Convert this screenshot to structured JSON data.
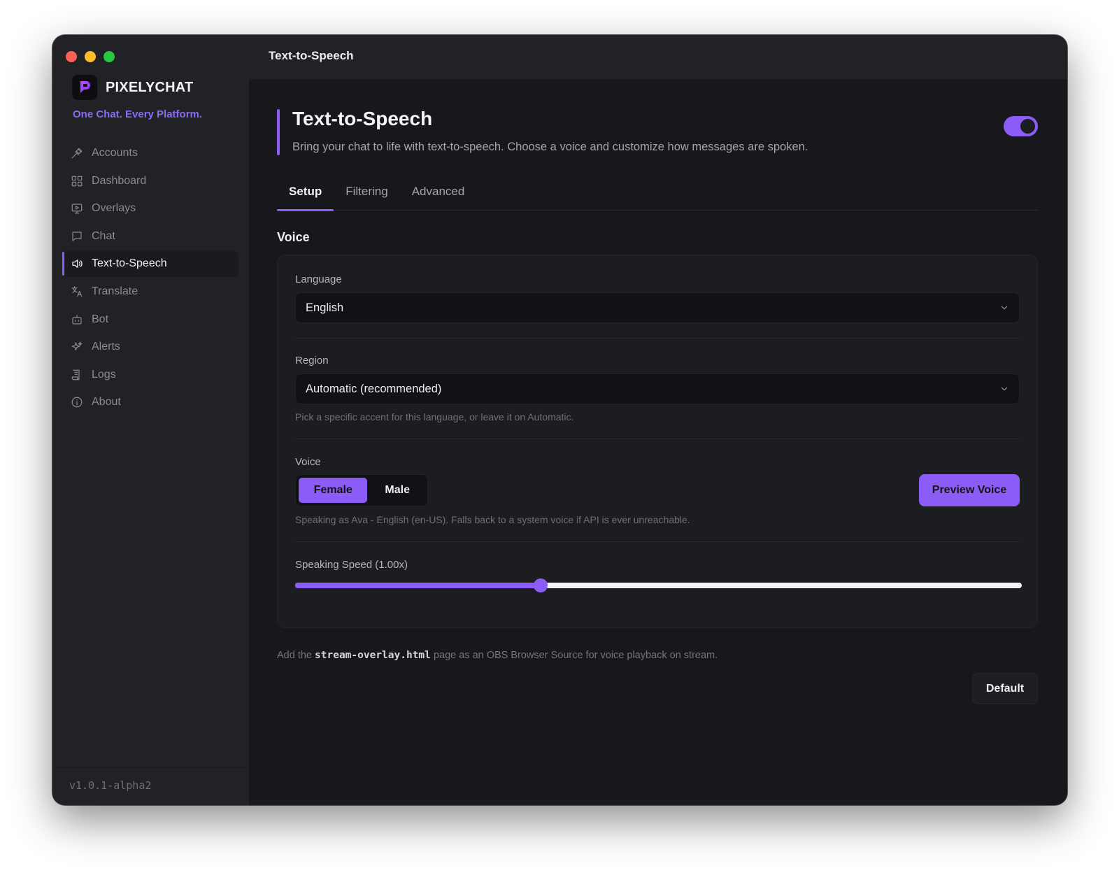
{
  "app": {
    "name": "PIXELYCHAT",
    "tagline": "One Chat. Every Platform.",
    "version": "v1.0.1-alpha2",
    "window_title": "Text-to-Speech",
    "accent_color": "#8b5cf6"
  },
  "sidebar": {
    "items": [
      {
        "label": "Accounts",
        "icon": "plug-icon",
        "active": false
      },
      {
        "label": "Dashboard",
        "icon": "dashboard-icon",
        "active": false
      },
      {
        "label": "Overlays",
        "icon": "monitor-play-icon",
        "active": false
      },
      {
        "label": "Chat",
        "icon": "chat-bubble-icon",
        "active": false
      },
      {
        "label": "Text-to-Speech",
        "icon": "speaker-icon",
        "active": true
      },
      {
        "label": "Translate",
        "icon": "translate-icon",
        "active": false
      },
      {
        "label": "Bot",
        "icon": "bot-icon",
        "active": false
      },
      {
        "label": "Alerts",
        "icon": "sparkles-icon",
        "active": false
      },
      {
        "label": "Logs",
        "icon": "logs-icon",
        "active": false
      },
      {
        "label": "About",
        "icon": "info-icon",
        "active": false
      }
    ]
  },
  "header": {
    "title": "Text-to-Speech",
    "description": "Bring your chat to life with text-to-speech. Choose a voice and customize how messages are spoken.",
    "enabled": true
  },
  "tabs": [
    {
      "label": "Setup",
      "active": true
    },
    {
      "label": "Filtering",
      "active": false
    },
    {
      "label": "Advanced",
      "active": false
    }
  ],
  "voice_section": {
    "title": "Voice",
    "language": {
      "label": "Language",
      "value": "English"
    },
    "region": {
      "label": "Region",
      "value": "Automatic (recommended)",
      "hint": "Pick a specific accent for this language, or leave it on Automatic."
    },
    "voice": {
      "label": "Voice",
      "options": [
        "Female",
        "Male"
      ],
      "selected": "Female",
      "preview_label": "Preview Voice",
      "hint": "Speaking as Ava - English (en-US). Falls back to a system voice if API is ever unreachable."
    },
    "speed": {
      "label": "Speaking Speed (1.00x)",
      "value": 1.0,
      "fraction": 0.338
    }
  },
  "footer": {
    "note_prefix": "Add the",
    "note_code": "stream-overlay.html",
    "note_suffix": "page as an OBS Browser Source for voice playback on stream.",
    "default_label": "Default"
  }
}
